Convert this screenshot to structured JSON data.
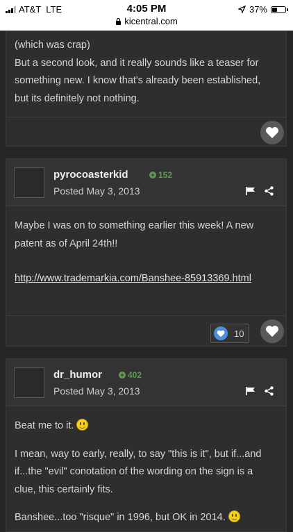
{
  "status_bar": {
    "carrier": "AT&T",
    "network": "LTE",
    "time": "4:05 PM",
    "battery": "37%",
    "url": "kicentral.com"
  },
  "posts": [
    {
      "body_lines": [
        "(which was crap)",
        "But a second look, and it really sounds like a teaser for something new. I know that's already been established, but its definitely not nothing."
      ]
    },
    {
      "author": "pyrocoasterkid",
      "reputation": "152",
      "posted": "Posted May 3, 2013",
      "body_text": "Maybe I was on to something earlier this week! A new patent as of April 24th!!",
      "link": "http://www.trademarkia.com/Banshee-85913369.html",
      "reaction_count": "10"
    },
    {
      "author": "dr_humor",
      "reputation": "402",
      "posted": "Posted May 3, 2013",
      "p1": "Beat me to it.",
      "p2": "I mean, way to early, really, to say \"this is it\", but if...and if...the \"evil\" conotation of the wording on the sign is a clue, this certainly fits.",
      "p3": "Banshee...too \"risque\" in 1996, but OK in 2014."
    }
  ],
  "icons": {
    "like": "heart-icon",
    "report": "flag-icon",
    "share": "share-icon",
    "reputation": "plus-circle-icon",
    "emoticon": "smiley-icon",
    "secure": "lock-icon"
  },
  "colors": {
    "background": "#262626",
    "card": "#2e2e2e",
    "reputation_green": "#5f9a50",
    "reaction_blue": "#4a90d9"
  }
}
